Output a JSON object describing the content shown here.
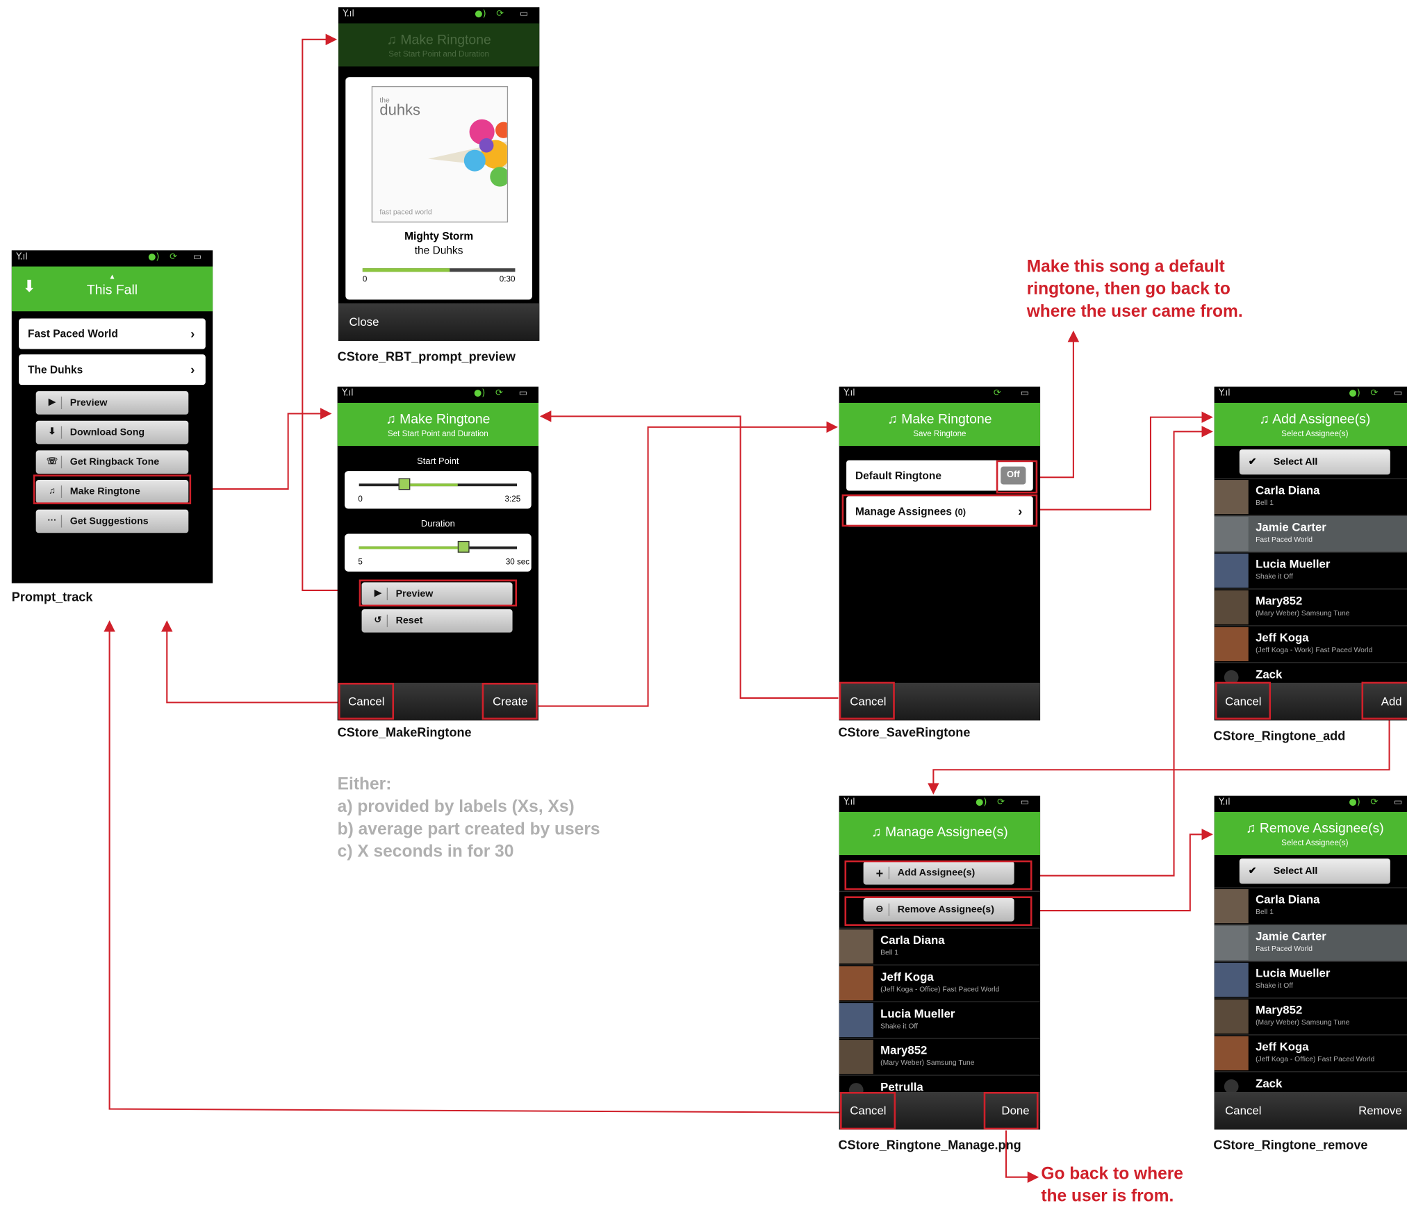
{
  "notes": {
    "default_ringtone": [
      "Make this song a default",
      "ringtone, then go back to",
      "where the user came from."
    ],
    "either": [
      "Either:",
      "a) provided by labels (Xs, Xs)",
      "b) average part created by users",
      "c) X seconds in for 30"
    ],
    "go_back": [
      "Go back to where",
      "the user is from."
    ]
  },
  "captions": {
    "prompt_track": "Prompt_track",
    "preview": "CStore_RBT_prompt_preview",
    "make": "CStore_MakeRingtone",
    "save": "CStore_SaveRingtone",
    "add": "CStore_Ringtone_add",
    "manage": "CStore_Ringtone_Manage.png",
    "remove": "CStore_Ringtone_remove"
  },
  "prompt_track": {
    "title": "This Fall",
    "rows": [
      {
        "label": "Fast Paced World"
      },
      {
        "label": "The Duhks"
      }
    ],
    "buttons": [
      {
        "label": "Preview",
        "icon": "▶"
      },
      {
        "label": "Download Song",
        "icon": "⬇"
      },
      {
        "label": "Get Ringback Tone",
        "icon": "☏"
      },
      {
        "label": "Make Ringtone",
        "icon": "♫"
      },
      {
        "label": "Get Suggestions",
        "icon": "···"
      }
    ]
  },
  "preview": {
    "title": "Make Ringtone",
    "subtitle": "Set Start Point and Duration",
    "album_brand": "duhks",
    "album_brand_small": "the",
    "album_caption": "fast paced world",
    "song": "Mighty Storm",
    "artist": "the Duhks",
    "time_start": "0",
    "time_end": "0:30",
    "progress": 0.57,
    "close": "Close"
  },
  "make": {
    "title": "Make Ringtone",
    "subtitle": "Set Start Point and Duration",
    "start_label": "Start Point",
    "start_min": "0",
    "start_max": "3:25",
    "duration_label": "Duration",
    "dur_min": "5",
    "dur_max": "30 sec",
    "preview": "Preview",
    "reset": "Reset",
    "cancel": "Cancel",
    "create": "Create"
  },
  "save": {
    "title": "Make Ringtone",
    "subtitle": "Save Ringtone",
    "default_label": "Default Ringtone",
    "toggle": "Off",
    "manage_label": "Manage Assignees",
    "manage_count": "(0)",
    "cancel": "Cancel"
  },
  "add": {
    "title": "Add Assignee(s)",
    "subtitle": "Select Assignee(s)",
    "select_all": "Select All",
    "people": [
      {
        "name": "Carla Diana",
        "detail": "Bell 1"
      },
      {
        "name": "Jamie Carter",
        "detail": "Fast Paced World"
      },
      {
        "name": "Lucia Mueller",
        "detail": "Shake it Off"
      },
      {
        "name": "Mary852",
        "detail": "(Mary Weber) Samsung Tune"
      },
      {
        "name": "Jeff Koga",
        "detail": "(Jeff Koga - Work) Fast Paced World"
      },
      {
        "name": "Zack",
        "detail": ""
      }
    ],
    "cancel": "Cancel",
    "ok": "Add"
  },
  "manage": {
    "title": "Manage Assignee(s)",
    "add_btn": "Add Assignee(s)",
    "remove_btn": "Remove Assignee(s)",
    "people": [
      {
        "name": "Carla Diana",
        "detail": "Bell 1"
      },
      {
        "name": "Jeff Koga",
        "detail": "(Jeff Koga - Office) Fast Paced World"
      },
      {
        "name": "Lucia Mueller",
        "detail": "Shake it Off"
      },
      {
        "name": "Mary852",
        "detail": "(Mary Weber) Samsung Tune"
      },
      {
        "name": "Petrulla",
        "detail": ""
      }
    ],
    "cancel": "Cancel",
    "done": "Done"
  },
  "remove": {
    "title": "Remove Assignee(s)",
    "subtitle": "Select Assignee(s)",
    "select_all": "Select All",
    "people": [
      {
        "name": "Carla Diana",
        "detail": "Bell 1"
      },
      {
        "name": "Jamie Carter",
        "detail": "Fast Paced World"
      },
      {
        "name": "Lucia Mueller",
        "detail": "Shake it Off"
      },
      {
        "name": "Mary852",
        "detail": "(Mary Weber) Samsung Tune"
      },
      {
        "name": "Jeff Koga",
        "detail": "(Jeff Koga - Office) Fast Paced World"
      },
      {
        "name": "Zack",
        "detail": ""
      }
    ],
    "cancel": "Cancel",
    "ok": "Remove"
  },
  "colors": {
    "accent": "#4cb830",
    "arrow": "#d0202a",
    "note_gray": "#b0b0b0"
  }
}
